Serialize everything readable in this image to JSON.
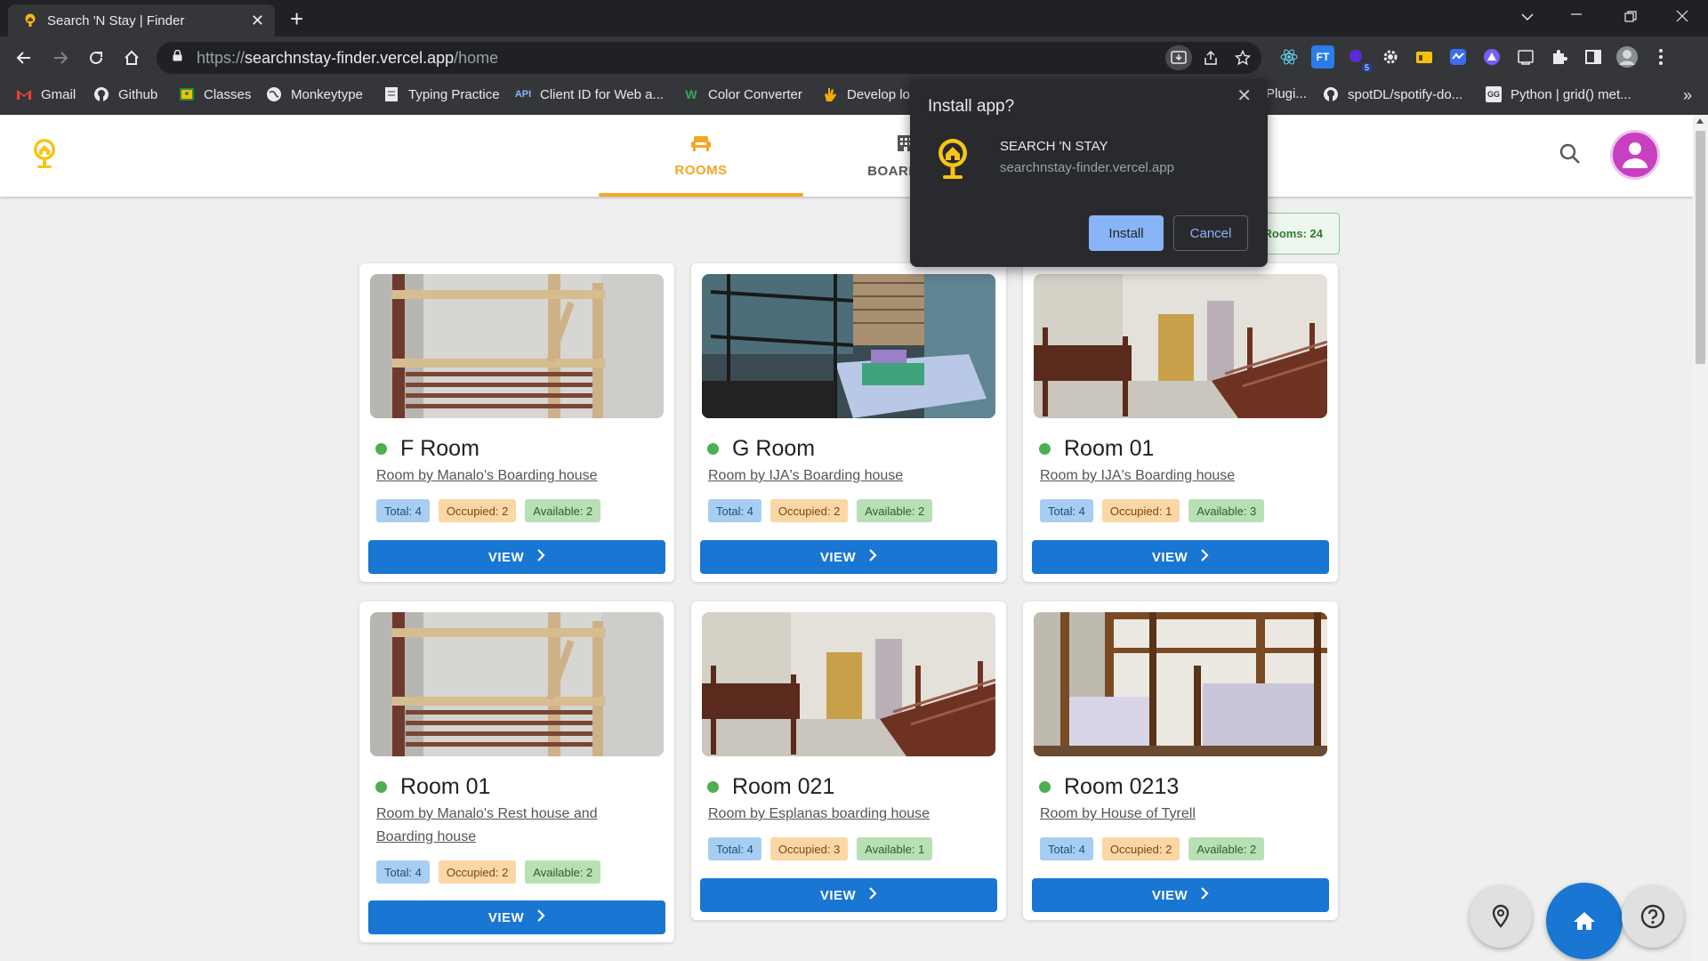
{
  "browser": {
    "tab_title": "Search 'N Stay | Finder",
    "url_scheme": "https://",
    "url_host": "searchnstay-finder.vercel.app",
    "url_path": "/home",
    "extension_badge": "5",
    "bookmarks": [
      {
        "label": "Gmail",
        "icon": "gmail-icon"
      },
      {
        "label": "Github",
        "icon": "github-icon"
      },
      {
        "label": "Classes",
        "icon": "classroom-icon"
      },
      {
        "label": "Monkeytype",
        "icon": "globe-icon"
      },
      {
        "label": "Typing Practice",
        "icon": "document-icon"
      },
      {
        "label": "Client ID for Web a...",
        "icon": "api-icon"
      },
      {
        "label": "Color Converter",
        "icon": "w-icon"
      },
      {
        "label": "Develop lo",
        "icon": "hand-icon"
      },
      {
        "label": "Plugi...",
        "icon": "plugin-icon"
      },
      {
        "label": "spotDL/spotify-do...",
        "icon": "github-icon"
      },
      {
        "label": "Python | grid() met...",
        "icon": "gfg-icon"
      }
    ],
    "bookmarks_more": "»"
  },
  "install_popup": {
    "title": "Install app?",
    "app_name": "SEARCH 'N STAY",
    "app_url": "searchnstay-finder.vercel.app",
    "install_label": "Install",
    "cancel_label": "Cancel"
  },
  "app": {
    "nav": [
      {
        "label": "ROOMS",
        "icon": "sofa-icon",
        "active": true
      },
      {
        "label": "BOARDING",
        "icon": "building-icon",
        "active": false
      }
    ],
    "rooms_count_label": "Rooms: 24"
  },
  "rooms": [
    {
      "name": "F Room",
      "subtitle": "Room by Manalo's Boarding house",
      "total": "Total: 4",
      "occupied": "Occupied: 2",
      "available": "Available: 2",
      "view": "VIEW",
      "photo": "wooden-bunk"
    },
    {
      "name": "G Room",
      "subtitle": "Room by IJA's Boarding house",
      "total": "Total: 4",
      "occupied": "Occupied: 2",
      "available": "Available: 2",
      "view": "VIEW",
      "photo": "dark-bed"
    },
    {
      "name": "Room 01",
      "subtitle": "Room by IJA's Boarding house",
      "total": "Total: 4",
      "occupied": "Occupied: 1",
      "available": "Available: 3",
      "view": "VIEW",
      "photo": "bunks-cabinet"
    },
    {
      "name": "Room 01",
      "subtitle": "Room by Manalo's Rest house and Boarding house",
      "total": "Total: 4",
      "occupied": "Occupied: 2",
      "available": "Available: 2",
      "view": "VIEW",
      "photo": "wooden-bunk"
    },
    {
      "name": "Room 021",
      "subtitle": "Room by Esplanas boarding house",
      "total": "Total: 4",
      "occupied": "Occupied: 3",
      "available": "Available: 1",
      "view": "VIEW",
      "photo": "bunks-cabinet"
    },
    {
      "name": "Room 0213",
      "subtitle": "Room by House of Tyrell",
      "total": "Total: 4",
      "occupied": "Occupied: 2",
      "available": "Available: 2",
      "view": "VIEW",
      "photo": "wood-beds"
    }
  ],
  "colors": {
    "accent": "#f5a623",
    "primary_button": "#1976d2",
    "status_available": "#4caf50",
    "avatar": "#c83fc1"
  }
}
